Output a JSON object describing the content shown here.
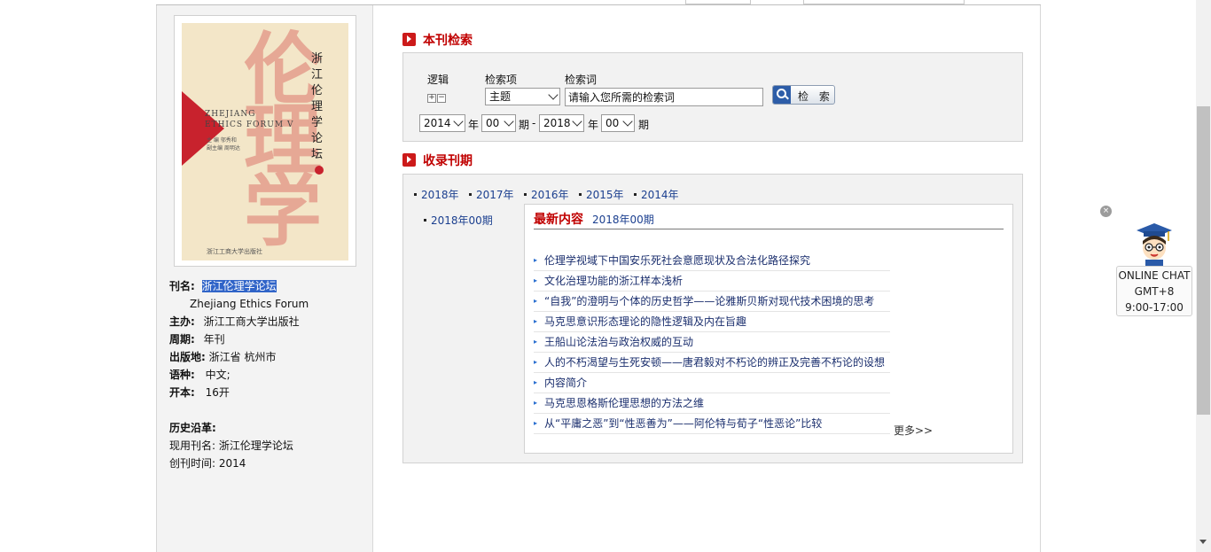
{
  "journal": {
    "cover": {
      "title_cn": "浙江伦理学论坛",
      "title_en_line1": "ZHEJIANG",
      "title_en_line2": "ETHICS FORUM V",
      "big_char_1": "伦",
      "big_char_2": "理",
      "big_char_3": "学",
      "editors_line1": "主 编  邬秀和",
      "editors_line2": "副主编  周明达",
      "publisher_mark": "浙江工商大学出版社"
    },
    "name_label": "刊名:",
    "name_value": "浙江伦理学论坛",
    "name_en": "Zhejiang Ethics Forum",
    "sponsor_label": "主办:",
    "sponsor_value": "浙江工商大学出版社",
    "cycle_label": "周期:",
    "cycle_value": "年刊",
    "place_label": "出版地:",
    "place_value": "浙江省 杭州市",
    "lang_label": "语种:",
    "lang_value": "中文;",
    "format_label": "开本:",
    "format_value": "16开",
    "history_label": "历史沿革:",
    "current_name_label": "现用刊名:",
    "current_name_value": "浙江伦理学论坛",
    "founded_label": "创刊时间:",
    "founded_value": "2014"
  },
  "search": {
    "section_title": "本刊检索",
    "logic_label": "逻辑",
    "field_label": "检索项",
    "keyword_label": "检索词",
    "plus": "+",
    "minus": "−",
    "field_value": "主题",
    "keyword_value": "请输入您所需的检索词",
    "button_label": "检 索",
    "from_year": "2014",
    "from_issue": "00",
    "to_year": "2018",
    "to_issue": "00",
    "year_unit": "年",
    "issue_unit": "期",
    "dash": "-"
  },
  "issues": {
    "section_title": "收录刊期",
    "years": [
      "2018年",
      "2017年",
      "2016年",
      "2015年",
      "2014年"
    ],
    "selected_issue": "2018年00期",
    "latest_title": "最新内容",
    "latest_issue": "2018年00期",
    "articles": [
      "伦理学视域下中国安乐死社会意愿现状及合法化路径探究",
      "文化治理功能的浙江样本浅析",
      "“自我”的澄明与个体的历史哲学——论雅斯贝斯对现代技术困境的思考",
      "马克思意识形态理论的隐性逻辑及内在旨趣",
      "王船山论法治与政治权威的互动",
      "人的不朽渴望与生死安顿——唐君毅对不朽论的辨正及完善不朽论的设想",
      "内容简介",
      "马克思恩格斯伦理思想的方法之维",
      "从“平庸之恶”到“性恶善为”——阿伦特与荀子“性恶论”比较"
    ],
    "more": "更多>>"
  },
  "chat": {
    "close": "×",
    "line1": "ONLINE CHAT",
    "line2": "GMT+8",
    "line3": "9:00-17:00"
  }
}
